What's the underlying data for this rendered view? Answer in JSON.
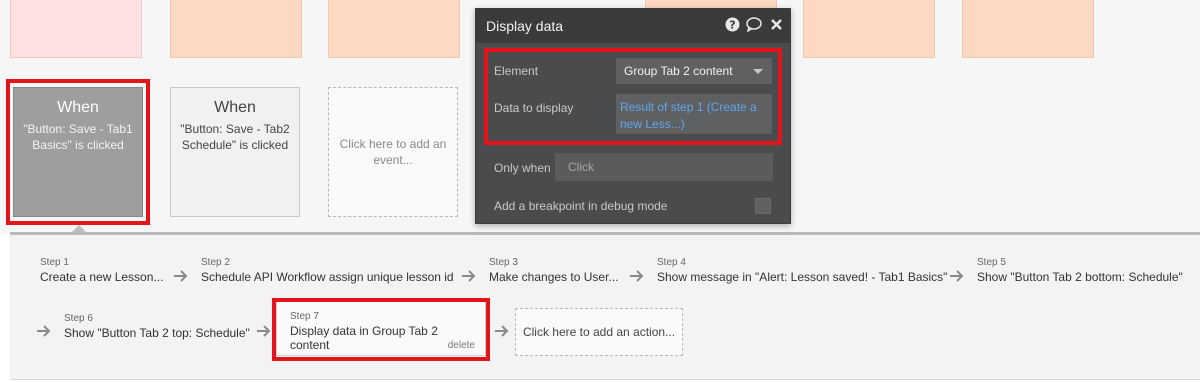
{
  "editor": {
    "title": "Display data",
    "element_label": "Element",
    "element_value": "Group Tab 2 content",
    "data_label": "Data to display",
    "data_value_line1": "Result of step 1 (Create a",
    "data_value_line2": "new Less...)",
    "only_when_label": "Only when",
    "only_when_placeholder": "Click",
    "breakpoint_label": "Add a breakpoint in debug mode",
    "icons": [
      "help-icon",
      "comment-icon",
      "close-icon"
    ],
    "accent_link_color": "#5ea8f0"
  },
  "events": [
    {
      "when": "When",
      "desc": "\"Button: Save - Tab1\nBasics\" is clicked"
    },
    {
      "when": "When",
      "desc": "\"Button: Save - Tab2\nSchedule\" is clicked"
    },
    {
      "add_label": "Click here to add an\nevent..."
    }
  ],
  "steps": [
    {
      "num": "Step 1",
      "label": "Create a new Lesson..."
    },
    {
      "num": "Step 2",
      "label": "Schedule API Workflow assign unique lesson id"
    },
    {
      "num": "Step 3",
      "label": "Make changes to User..."
    },
    {
      "num": "Step 4",
      "label": "Show message in \"Alert: Lesson saved! - Tab1 Basics\""
    },
    {
      "num": "Step 5",
      "label": "Show \"Button Tab 2 bottom: Schedule\""
    },
    {
      "num": "Step 6",
      "label": "Show \"Button Tab 2 top: Schedule\""
    },
    {
      "num": "Step 7",
      "label": "Display data in Group Tab 2 content",
      "delete": "delete"
    }
  ],
  "add_action_label": "Click here to add an action...",
  "colors": {
    "highlight": "#e3141a",
    "top_blocks": "#fdd9c4",
    "top_block_pink": "#fde1e1"
  }
}
